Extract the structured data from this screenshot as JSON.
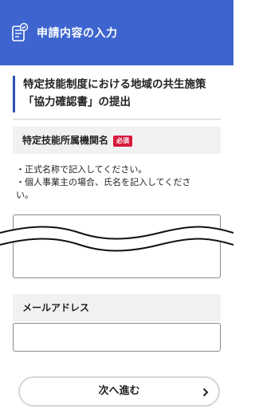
{
  "header": {
    "title": "申請内容の入力",
    "icon": "document-checklist-icon"
  },
  "section": {
    "title_line1": "特定技能制度における地域の共生施策",
    "title_line2": "「協力確認書」の提出"
  },
  "field_org": {
    "label": "特定技能所属機関名",
    "required_badge": "必須",
    "notes": [
      "・正式名称で記入してください。",
      "・個人事業主の場合、氏名を記入してくださ",
      "い。"
    ],
    "value": ""
  },
  "field_email": {
    "label": "メールアドレス",
    "value": ""
  },
  "next_button": {
    "label": "次へ進む",
    "icon": "chevron-right-icon"
  },
  "colors": {
    "header_bg": "#3d64cf",
    "accent": "#2c4fb5",
    "required_badge": "#d8183c"
  }
}
